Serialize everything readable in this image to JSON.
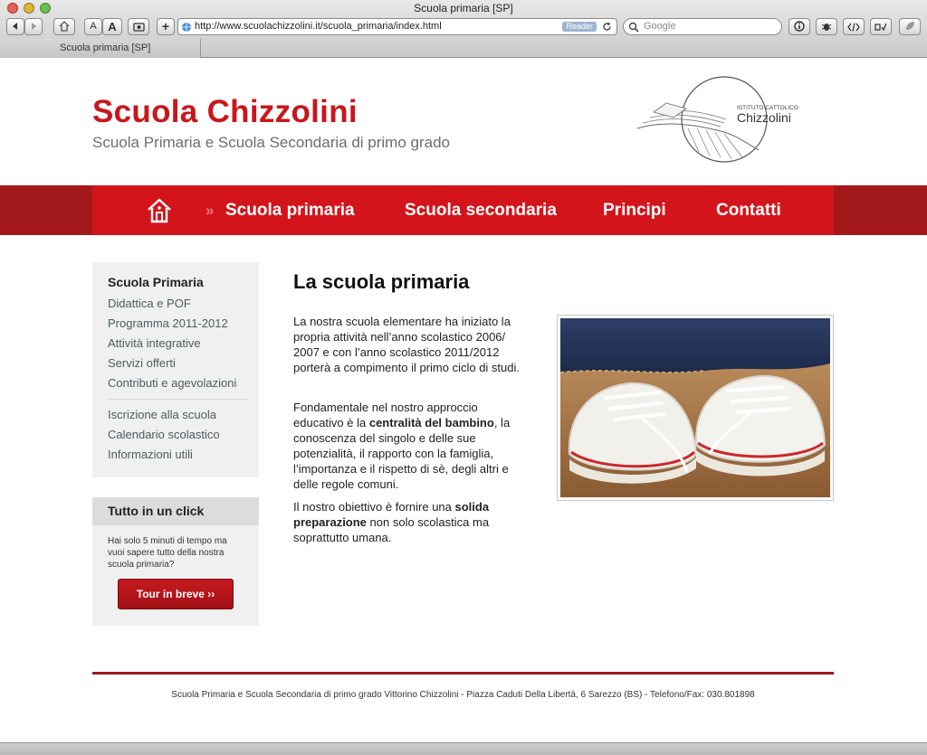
{
  "browser": {
    "window_title": "Scuola primaria [SP]",
    "url": "http://www.scuolachizzolini.it/scuola_primaria/index.html",
    "reader_label": "Reader",
    "search_placeholder": "Google",
    "tab_label": "Scuola primaria [SP]",
    "font_small_label": "A",
    "font_large_label": "A",
    "new_tab_label": "+"
  },
  "header": {
    "title": "Scuola Chizzolini",
    "subtitle": "Scuola Primaria e Scuola Secondaria di primo grado",
    "logo_line1": "ISTITUTO CATTOLICO",
    "logo_line2": "Chizzolini"
  },
  "nav": {
    "marker": "»",
    "items": [
      "Scuola primaria",
      "Scuola secondaria",
      "Principi",
      "Contatti"
    ]
  },
  "sidebar": {
    "heading": "Scuola Primaria",
    "group1": [
      "Didattica e POF",
      "Programma 2011-2012",
      "Attività integrative",
      "Servizi offerti",
      "Contributi e agevolazioni"
    ],
    "group2": [
      "Iscrizione alla scuola",
      "Calendario scolastico",
      "Informazioni utili"
    ]
  },
  "click_box": {
    "heading": "Tutto in un click",
    "text": "Hai solo 5 minuti di tempo ma vuoi sapere tutto della nostra scuola primaria?",
    "button": "Tour in breve ››"
  },
  "content": {
    "title": "La scuola primaria",
    "p1": "La nostra scuola elementare ha iniziato la propria attività nell’anno scolastico 2006/ 2007 e con l’anno scolastico 2011/2012 porterà a compimento il primo ciclo di studi.",
    "p2_before": "Fondamentale nel nostro approccio educativo è la ",
    "p2_bold": "centralità del bambino",
    "p2_after": ", la conoscenza del singolo e delle sue potenzialità, il rapporto con la famiglia, l’importanza e il rispetto di sè, degli altri e delle regole comuni.",
    "p3_before": "Il nostro obiettivo è fornire una ",
    "p3_bold": "solida preparazione",
    "p3_after": " non solo scolastica ma soprattutto umana."
  },
  "footer": {
    "text": "Scuola Primaria e Scuola Secondaria di primo grado Vittorino Chizzolini - Piazza Caduti Della Libertà, 6 Sarezzo (BS) - Telefono/Fax: 030.801898"
  },
  "colors": {
    "brand_red": "#d4141b",
    "dark_red": "#a2181b",
    "sidebar_bg": "#f0f0f0"
  }
}
